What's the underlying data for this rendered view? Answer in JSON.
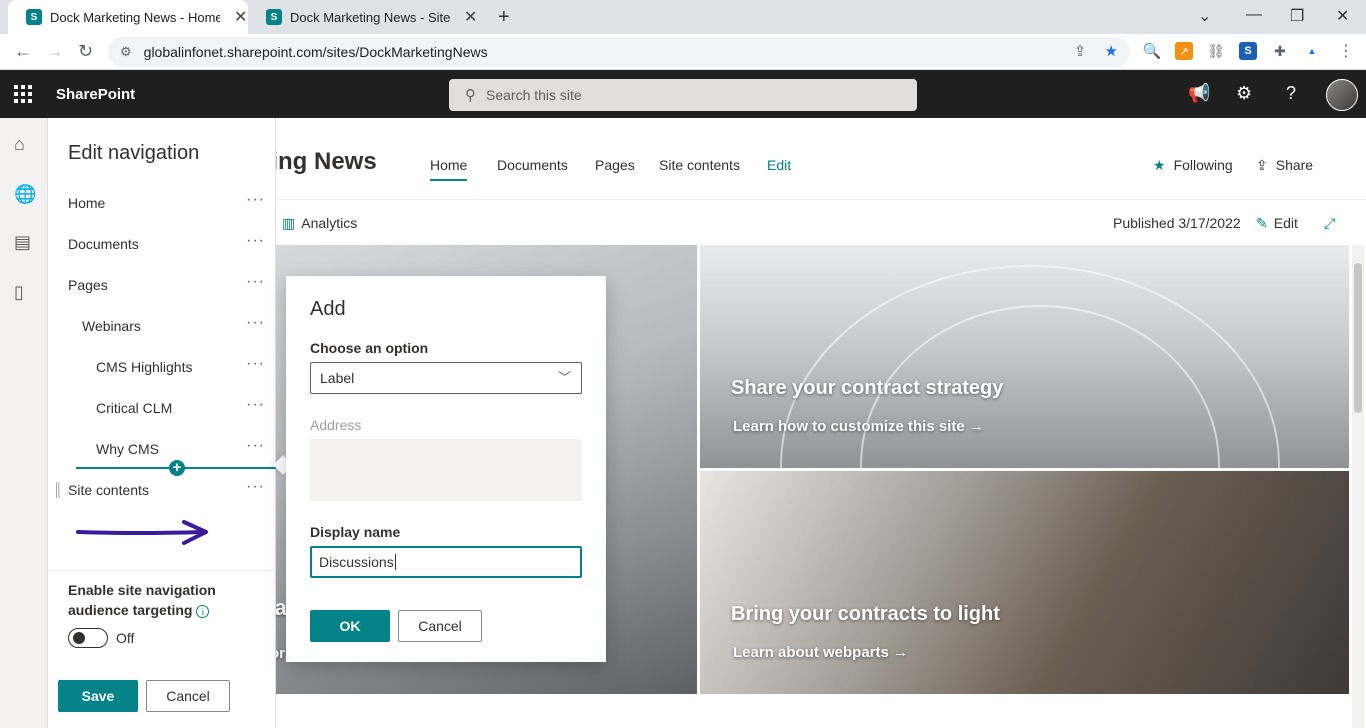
{
  "browser": {
    "tabs": [
      {
        "title": "Dock Marketing News - Home",
        "active": true
      },
      {
        "title": "Dock Marketing News - Site Page",
        "active": false
      }
    ],
    "favicon_letter": "S",
    "url": "globalinfonet.sharepoint.com/sites/DockMarketingNews"
  },
  "suitebar": {
    "brand": "SharePoint",
    "search_placeholder": "Search this site"
  },
  "nav_panel": {
    "title": "Edit navigation",
    "items": [
      {
        "label": "Home"
      },
      {
        "label": "Documents"
      },
      {
        "label": "Pages"
      },
      {
        "label": "Webinars"
      },
      {
        "label": "CMS Highlights"
      },
      {
        "label": "Critical CLM"
      },
      {
        "label": "Why CMS"
      },
      {
        "label": "Site contents"
      }
    ],
    "more_glyph": "···",
    "audience_label": "Enable site navigation audience targeting",
    "toggle_state": "Off",
    "save_label": "Save",
    "cancel_label": "Cancel"
  },
  "site": {
    "title": "eting News",
    "nav": [
      {
        "label": "Home",
        "active": true
      },
      {
        "label": "Documents"
      },
      {
        "label": "Pages"
      },
      {
        "label": "Site contents"
      },
      {
        "label": "Edit"
      }
    ],
    "following_label": "Following",
    "share_label": "Share",
    "analytics_label": "Analytics",
    "published_label": "Published 3/17/2022",
    "edit_label": "Edit"
  },
  "hero": {
    "left_partial_heading": "ra",
    "left_partial_link": "or",
    "tiles": [
      {
        "heading": "Share your contract strategy",
        "link": "Learn how to customize this site →"
      },
      {
        "heading": "Bring your contracts to light",
        "link": "Learn about webparts →"
      }
    ]
  },
  "dialog": {
    "title": "Add",
    "choose_label": "Choose an option",
    "choose_value": "Label",
    "address_label": "Address",
    "display_name_label": "Display name",
    "display_name_value": "Discussions",
    "ok_label": "OK",
    "cancel_label": "Cancel"
  },
  "colors": {
    "accent": "#038387",
    "suitebar": "#1f1f1f",
    "annotation_arrow": "#3b1a9e"
  }
}
